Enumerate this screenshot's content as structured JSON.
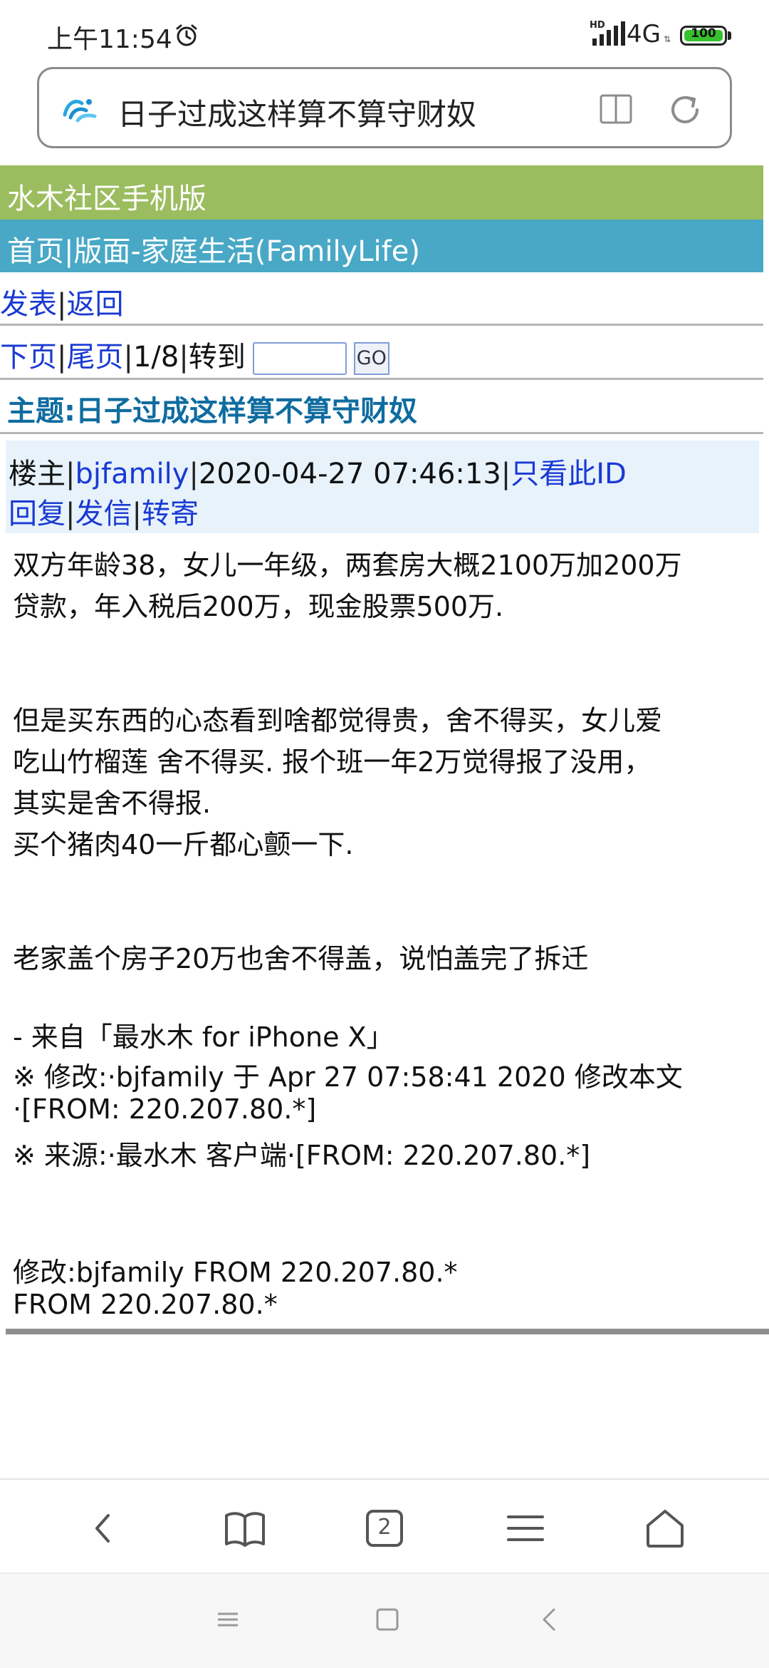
{
  "status_bar": {
    "time": "上午11:54",
    "hd_label": "HD",
    "network": "4G",
    "battery": "100"
  },
  "address_bar": {
    "text": "日子过成这样算不算守财奴"
  },
  "site": {
    "title": "水木社区手机版",
    "board": "首页|版面-家庭生活(FamilyLife)",
    "post_link": "发表",
    "back_link": "返回",
    "next_page": "下页",
    "last_page": "尾页",
    "page_indicator": "1/8",
    "goto_label": "转到",
    "go_button": "GO",
    "subject": "主题:日子过成这样算不算守财奴"
  },
  "post": {
    "role": "楼主",
    "author": "bjfamily",
    "datetime": "2020-04-27 07:46:13",
    "only_this_id": "只看此ID",
    "reply": "回复",
    "send_mail": "发信",
    "forward": "转寄",
    "content_lines": [
      "双方年龄38，女儿一年级，两套房大概2100万加200万",
      "贷款，年入税后200万，现金股票500万.",
      "但是买东西的心态看到啥都觉得贵，舍不得买，女儿爱",
      "吃山竹榴莲 舍不得买. 报个班一年2万觉得报了没用，",
      "其实是舍不得报.",
      "买个猪肉40一斤都心颤一下.",
      "老家盖个房子20万也舍不得盖，说怕盖完了拆迁",
      "- 来自「最水木 for iPhone X」",
      "※ 修改:·bjfamily 于 Apr 27 07:58:41 2020 修改本文",
      "·[FROM: 220.207.80.*]",
      "※ 来源:·最水木 客户端·[FROM: 220.207.80.*]",
      "修改:bjfamily FROM 220.207.80.*",
      "FROM 220.207.80.*"
    ]
  },
  "toolbar": {
    "tab_count": "2"
  },
  "colors": {
    "site_header": "#9bbd5f",
    "board_header": "#49a8c6",
    "link": "#1a3ad3",
    "subject": "#0f6ca0",
    "meta_bg": "#e7f2fb",
    "battery": "#36c12e"
  }
}
